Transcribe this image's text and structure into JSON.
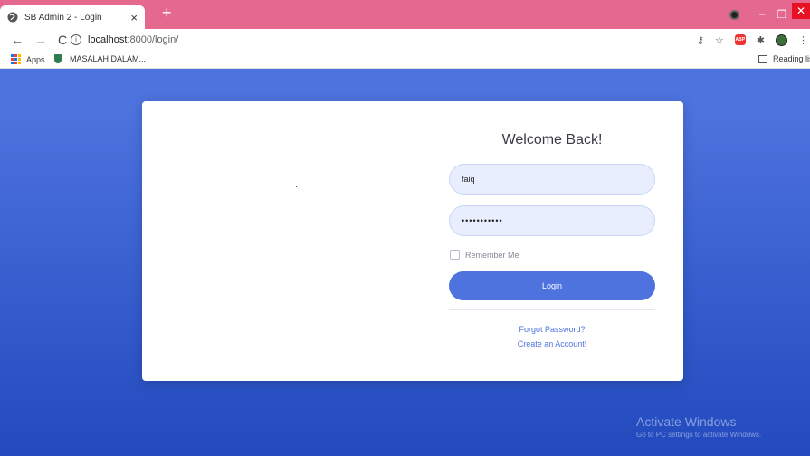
{
  "browser": {
    "tab_title": "SB Admin 2 - Login",
    "tab_close": "×",
    "new_tab": "+",
    "url_host": "localhost",
    "url_path": ":8000/login/",
    "tabstrip_color": "#e5688e",
    "bookmarks": {
      "apps": "Apps",
      "masalah": "MASALAH DALAM...",
      "reading_list": "Reading lis"
    }
  },
  "login": {
    "heading": "Welcome Back!",
    "username_value": "faiq",
    "password_value": "•••••••••••",
    "remember_label": "Remember Me",
    "login_button": "Login",
    "forgot_link": "Forgot Password?",
    "create_link": "Create an Account!"
  },
  "watermark": {
    "title": "Activate Windows",
    "subtitle": "Go to PC settings to activate Windows."
  },
  "colors": {
    "primary": "#4e73df",
    "gradient_end": "#224abe"
  }
}
